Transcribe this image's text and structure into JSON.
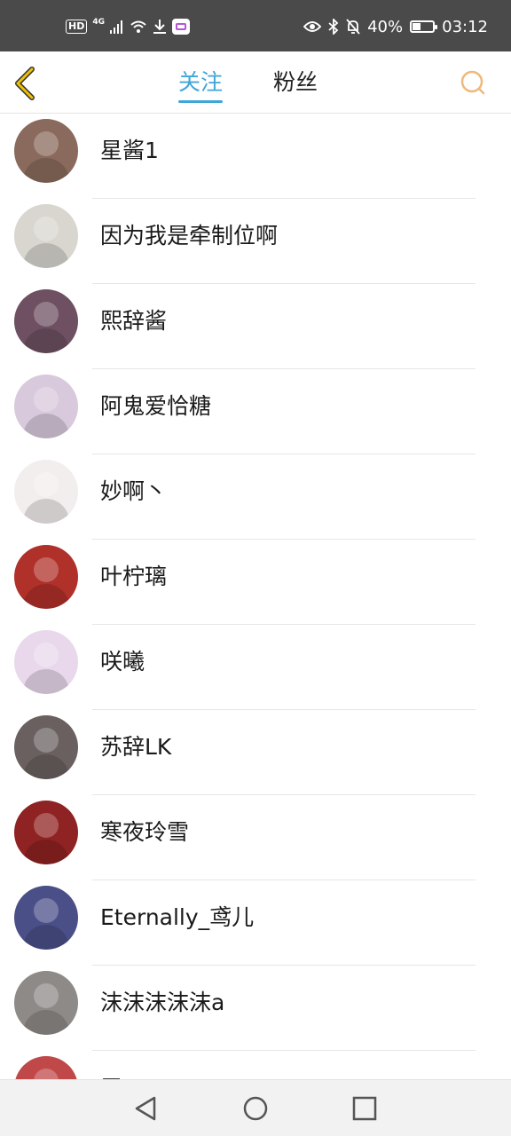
{
  "status_bar": {
    "hd": "HD",
    "network": "4G",
    "battery_percent": "40%",
    "battery_level": 0.4,
    "time": "03:12",
    "icons": [
      "signal-icon",
      "wifi-icon",
      "download-icon",
      "app-notification-icon",
      "eye-icon",
      "bluetooth-icon",
      "bell-off-icon",
      "battery-icon"
    ]
  },
  "header": {
    "back_icon": "chevron-left-icon",
    "tabs": [
      {
        "label": "关注",
        "active": true
      },
      {
        "label": "粉丝",
        "active": false
      }
    ],
    "search_icon": "search-icon",
    "colors": {
      "active_tab": "#3fa7d8",
      "back_icon": "#f2c200",
      "search_icon": "#f0b87a"
    }
  },
  "users": [
    {
      "name": "星酱1",
      "avatar_color": "#8a6a5c"
    },
    {
      "name": "因为我是牵制位啊",
      "avatar_color": "#d8d6cf"
    },
    {
      "name": "熙辞酱",
      "avatar_color": "#6e5062"
    },
    {
      "name": "阿鬼爱恰糖",
      "avatar_color": "#d9c9dd"
    },
    {
      "name": "妙啊丶",
      "avatar_color": "#f3eeee"
    },
    {
      "name": "叶柠璃",
      "avatar_color": "#b0302a"
    },
    {
      "name": "咲曦",
      "avatar_color": "#e9d8ec"
    },
    {
      "name": "苏辞LK",
      "avatar_color": "#6a6060"
    },
    {
      "name": "寒夜玲雪",
      "avatar_color": "#8f2222"
    },
    {
      "name": "Eternally_鸢儿",
      "avatar_color": "#4a4f88"
    },
    {
      "name": "沫沫沫沫沫a",
      "avatar_color": "#8e8a88"
    },
    {
      "name": "三",
      "avatar_color": "#c04848"
    }
  ],
  "nav_bar": {
    "icons": [
      "back-triangle-icon",
      "home-circle-icon",
      "recents-square-icon"
    ]
  }
}
